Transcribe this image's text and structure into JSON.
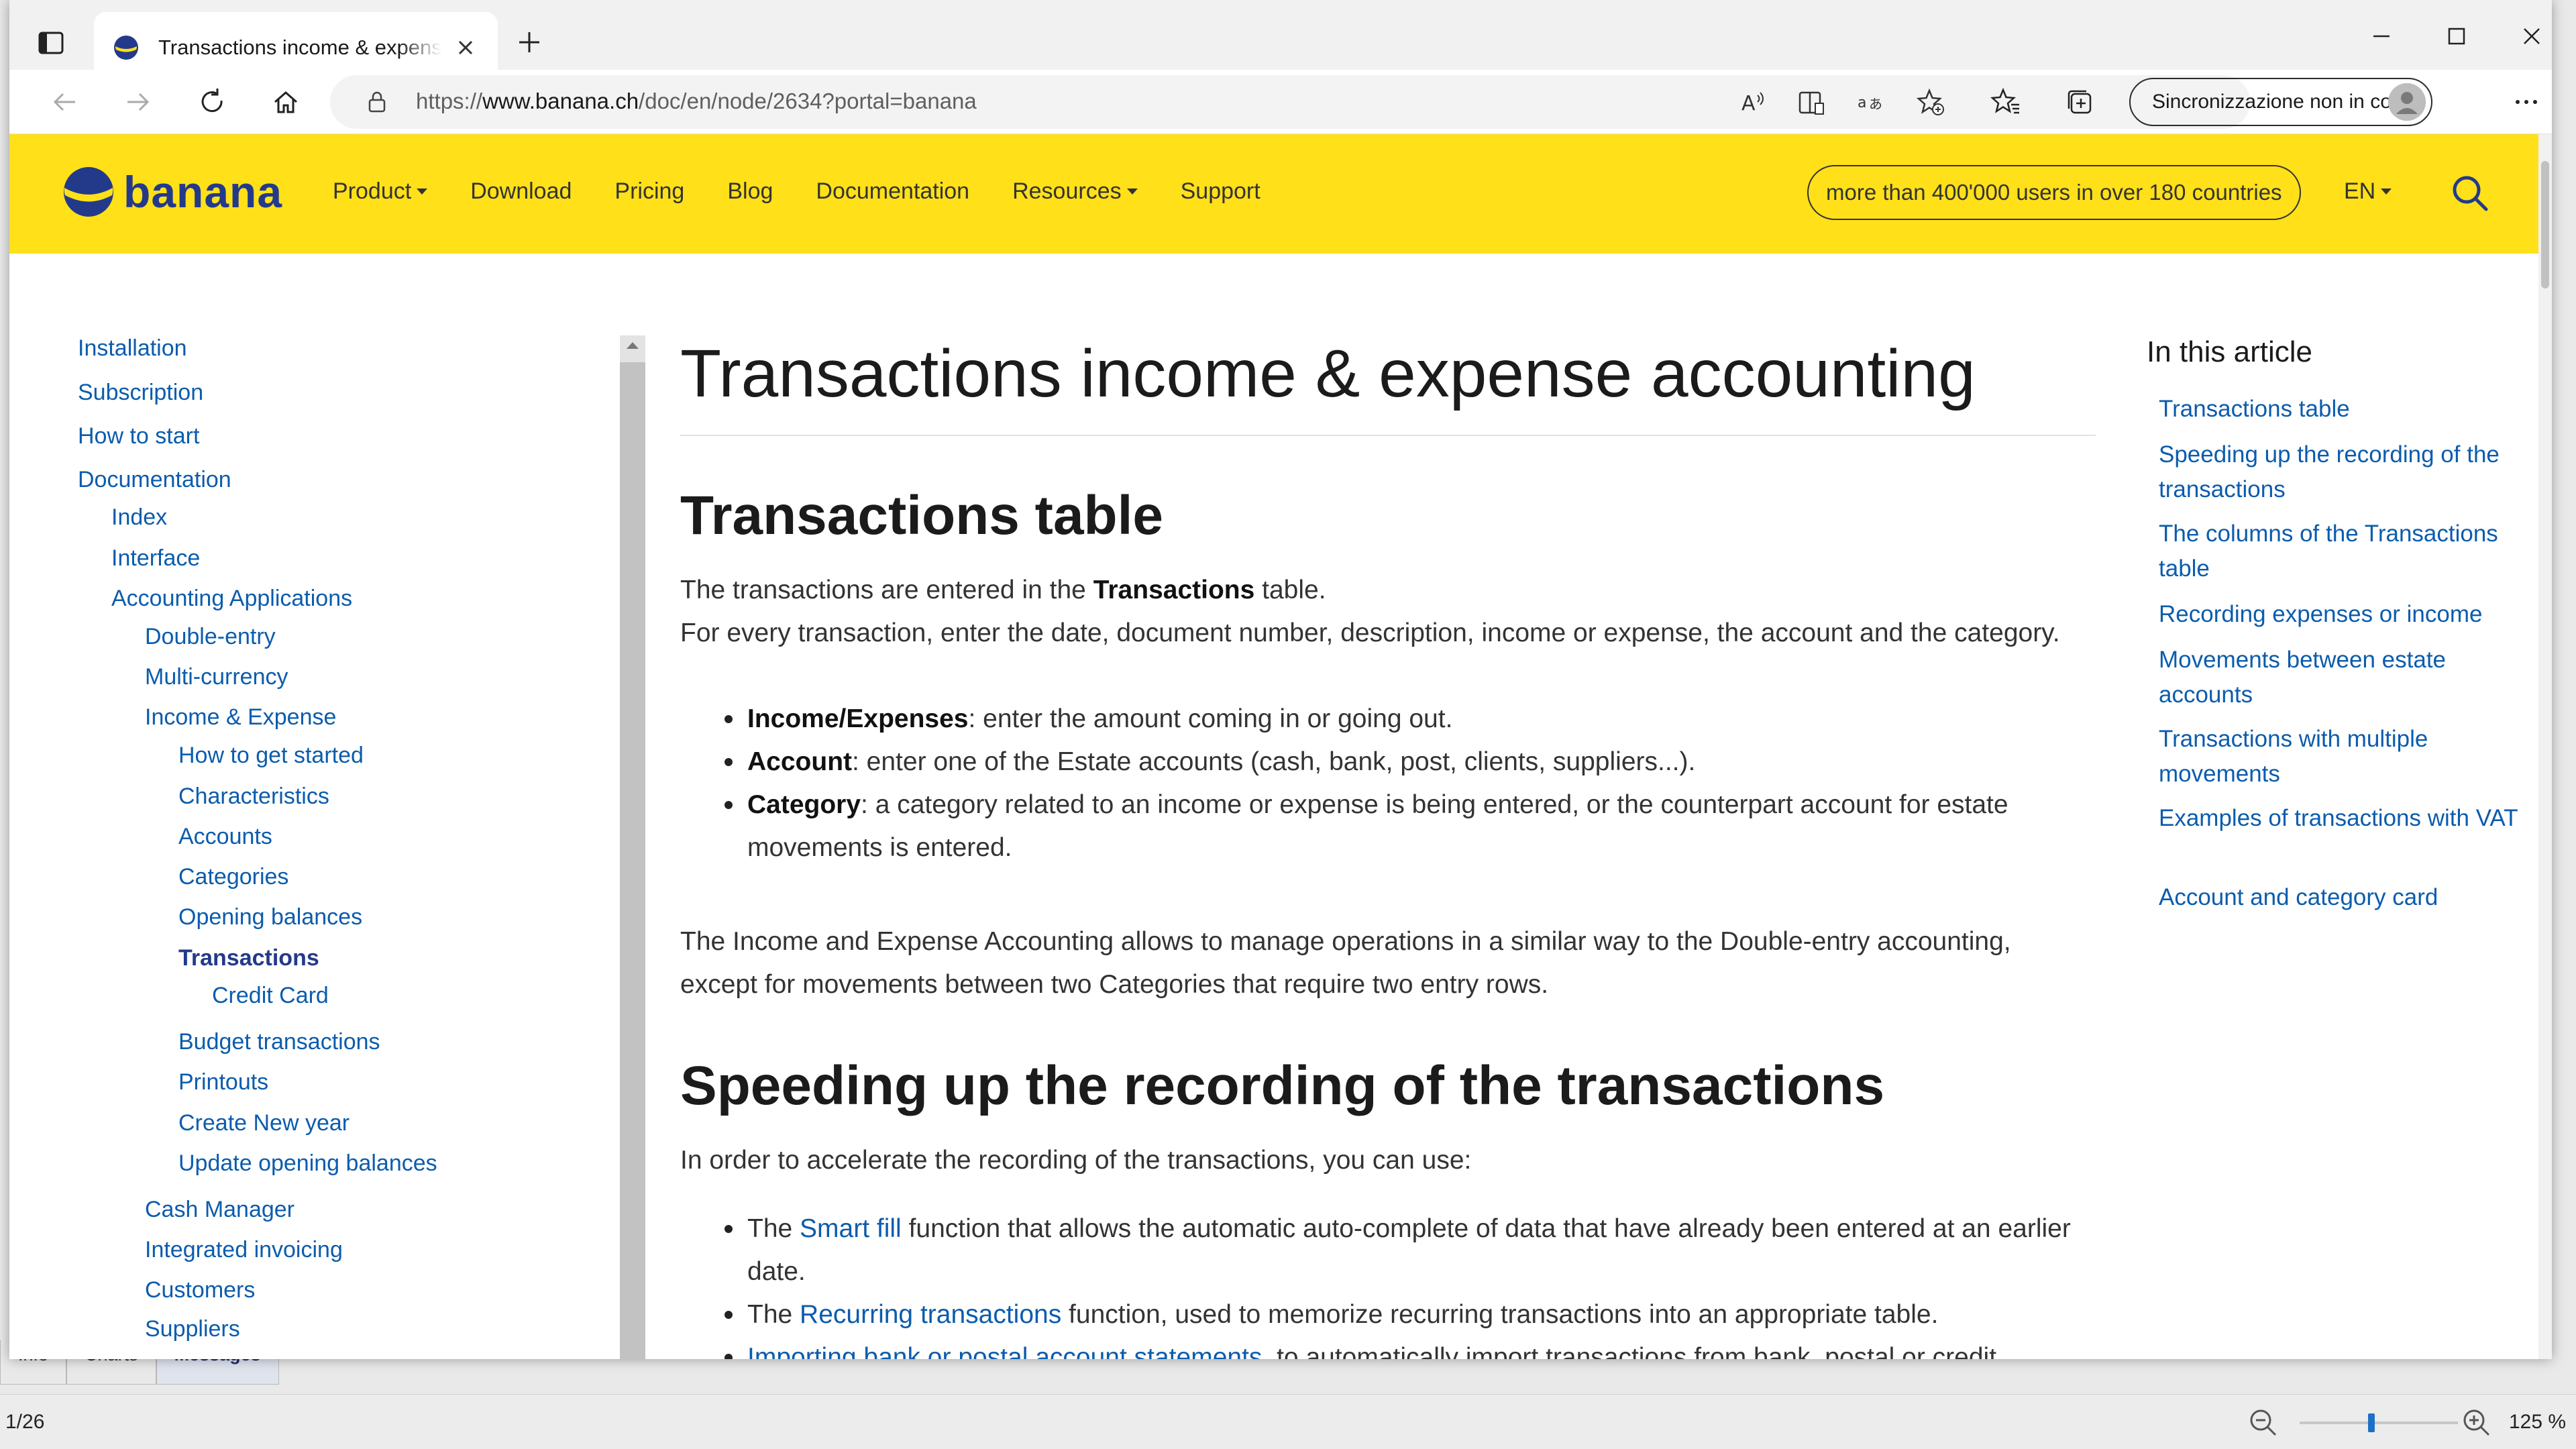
{
  "background_app": {
    "tabs": [
      "Info",
      "Charts",
      "Messages"
    ],
    "active_tab": "Messages",
    "status": {
      "page_indicator": "1/26",
      "zoom": "125 %",
      "zoom_level_fraction": 0.45
    }
  },
  "browser": {
    "tab": {
      "title": "Transactions income & expense accounting"
    },
    "url": {
      "prefix": "https://",
      "host": "www.banana.ch",
      "path": "/doc/en/node/2634?portal=banana"
    },
    "sync_label": "Sincronizzazione non in corso",
    "icons": [
      "tab-actions-icon",
      "back-icon",
      "forward-icon",
      "refresh-icon",
      "home-icon",
      "lock-icon",
      "read-aloud-icon",
      "immersive-reader-icon",
      "translate-icon",
      "add-favorite-icon",
      "favorites-icon",
      "collections-icon",
      "more-icon"
    ]
  },
  "site": {
    "logo_text": "banana",
    "nav": [
      {
        "label": "Product",
        "dropdown": true
      },
      {
        "label": "Download",
        "dropdown": false
      },
      {
        "label": "Pricing",
        "dropdown": false
      },
      {
        "label": "Blog",
        "dropdown": false
      },
      {
        "label": "Documentation",
        "dropdown": false
      },
      {
        "label": "Resources",
        "dropdown": true
      },
      {
        "label": "Support",
        "dropdown": false
      }
    ],
    "users_badge": "more than 400'000 users in over 180 countries",
    "language": "EN",
    "colors": {
      "header": "#ffe019",
      "brand": "#233a8b",
      "link": "#0b5cad"
    }
  },
  "sidebar": [
    {
      "label": "Installation",
      "level": 0
    },
    {
      "label": "Subscription",
      "level": 0
    },
    {
      "label": "How to start",
      "level": 0
    },
    {
      "label": "Documentation",
      "level": 0
    },
    {
      "label": "Index",
      "level": 1
    },
    {
      "label": "Interface",
      "level": 1
    },
    {
      "label": "Accounting Applications",
      "level": 1
    },
    {
      "label": "Double-entry",
      "level": 2
    },
    {
      "label": "Multi-currency",
      "level": 2
    },
    {
      "label": "Income & Expense",
      "level": 2
    },
    {
      "label": "How to get started",
      "level": 3
    },
    {
      "label": "Characteristics",
      "level": 3
    },
    {
      "label": "Accounts",
      "level": 3
    },
    {
      "label": "Categories",
      "level": 3
    },
    {
      "label": "Opening balances",
      "level": 3
    },
    {
      "label": "Transactions",
      "level": 3,
      "active": true
    },
    {
      "label": "Credit Card",
      "level": 4
    },
    {
      "label": "Budget transactions",
      "level": 3
    },
    {
      "label": "Printouts",
      "level": 3
    },
    {
      "label": "Create New year",
      "level": 3
    },
    {
      "label": "Update opening balances",
      "level": 3
    },
    {
      "label": "Cash Manager",
      "level": 2
    },
    {
      "label": "Integrated invoicing",
      "level": 2
    },
    {
      "label": "Customers",
      "level": 2
    },
    {
      "label": "Suppliers",
      "level": 2
    }
  ],
  "article": {
    "title": "Transactions income & expense accounting",
    "section1": {
      "heading": "Transactions table",
      "intro_before": "The transactions are entered in the ",
      "intro_bold": "Transactions",
      "intro_after": " table.",
      "intro2": "For every transaction, enter the date, document number, description, income or expense, the account and the category.",
      "bullets": [
        {
          "term": "Income/Expenses",
          "text": ": enter the amount coming in or going out."
        },
        {
          "term": "Account",
          "text": ": enter one of the Estate accounts (cash, bank, post, clients, suppliers...)."
        },
        {
          "term": "Category",
          "text": ": a category related to an income or expense is being entered, or the counterpart account for estate movements is entered."
        }
      ],
      "closing": "The Income and Expense Accounting allows to manage operations in a similar way to the Double-entry accounting, except for movements between two Categories that require two entry rows."
    },
    "section2": {
      "heading": "Speeding up the recording of the transactions",
      "intro": "In order to accelerate the recording of the transactions, you can use:",
      "bullets": [
        {
          "before": "The ",
          "link": "Smart fill",
          "after": " function that allows the automatic auto-complete of data that have already been entered at an earlier date."
        },
        {
          "before": "The ",
          "link": "Recurring transactions",
          "after": " function, used to memorize recurring transactions into an appropriate table."
        },
        {
          "before": "",
          "link": "Importing bank or postal account statements",
          "after": ", to automatically import transactions from bank, postal or credit"
        }
      ]
    }
  },
  "toc": {
    "heading": "In this article",
    "items": [
      "Transactions table",
      "Speeding up the recording of the transactions",
      "The columns of the Transactions table",
      "Recording expenses or income",
      "Movements between estate accounts",
      "Transactions with multiple movements",
      "Examples of transactions with VAT",
      "Account and category card"
    ]
  }
}
